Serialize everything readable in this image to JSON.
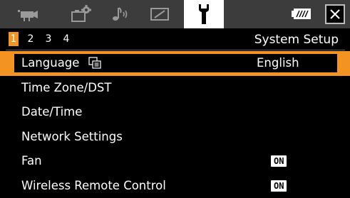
{
  "tabs": [
    {
      "name": "camera",
      "icon": "movie-camera-icon"
    },
    {
      "name": "recording",
      "icon": "camera-settings-icon"
    },
    {
      "name": "audio",
      "icon": "audio-icon"
    },
    {
      "name": "display",
      "icon": "display-icon"
    },
    {
      "name": "setup",
      "icon": "wrench-icon",
      "active": true
    }
  ],
  "pages": [
    "1",
    "2",
    "3",
    "4"
  ],
  "active_page": "1",
  "section_title": "System Setup",
  "menu": {
    "language": {
      "label": "Language",
      "value": "English"
    },
    "timezone": {
      "label": "Time Zone/DST"
    },
    "datetime": {
      "label": "Date/Time"
    },
    "network": {
      "label": "Network Settings"
    },
    "fan": {
      "label": "Fan",
      "value": "ON"
    },
    "remote": {
      "label": "Wireless Remote Control",
      "value": "ON"
    }
  },
  "colors": {
    "accent": "#f39321",
    "tabbar": "#3c3c3c",
    "background": "#000000"
  }
}
